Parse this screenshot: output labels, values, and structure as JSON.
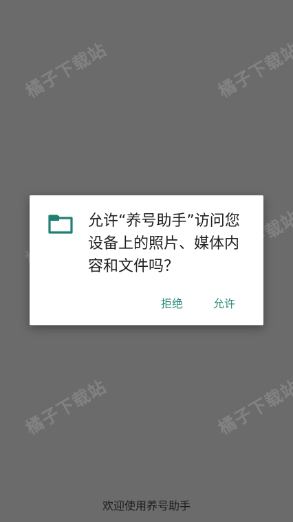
{
  "watermark": {
    "text": "橘子下载站"
  },
  "dialog": {
    "icon": "folder-icon",
    "message": "允许“养号助手”访问您设备上的照片、媒体内容和文件吗？",
    "deny_label": "拒绝",
    "allow_label": "允许",
    "accent_color": "#2a8a7b"
  },
  "footer": {
    "welcome_text": "欢迎使用养号助手"
  },
  "colors": {
    "scrim": "#6b6b6b",
    "dialog_bg": "#ffffff"
  }
}
